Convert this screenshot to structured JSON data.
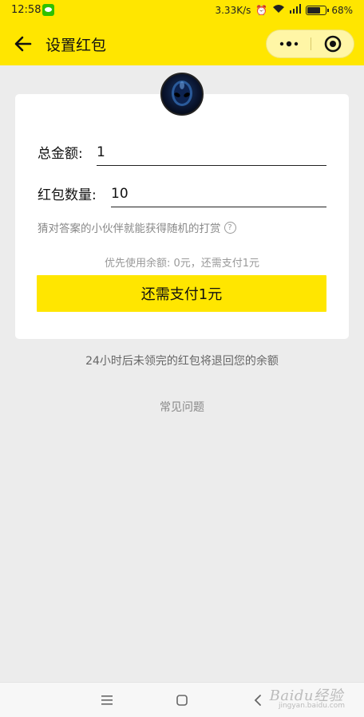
{
  "status_bar": {
    "time": "12:58",
    "network_speed": "3.33K/s",
    "battery_percent": "68%"
  },
  "header": {
    "title": "设置红包",
    "capsule_more_icon": "more-dots-icon",
    "capsule_close_icon": "target-close-icon"
  },
  "form": {
    "total_amount_label": "总金额:",
    "total_amount_value": "1",
    "count_label": "红包数量:",
    "count_value": "10",
    "hint": "猜对答案的小伙伴就能获得随机的打赏",
    "help_icon": "?",
    "balance_note": "优先使用余额: 0元，还需支付1元",
    "pay_button": "还需支付1元"
  },
  "refund_note": "24小时后未领完的红包将退回您的余额",
  "faq_link": "常见问题",
  "watermark": {
    "text": "Baidu经验",
    "sub": "jingyan.baidu.com"
  },
  "colors": {
    "brand_yellow": "#ffe600",
    "background": "#ececec"
  }
}
